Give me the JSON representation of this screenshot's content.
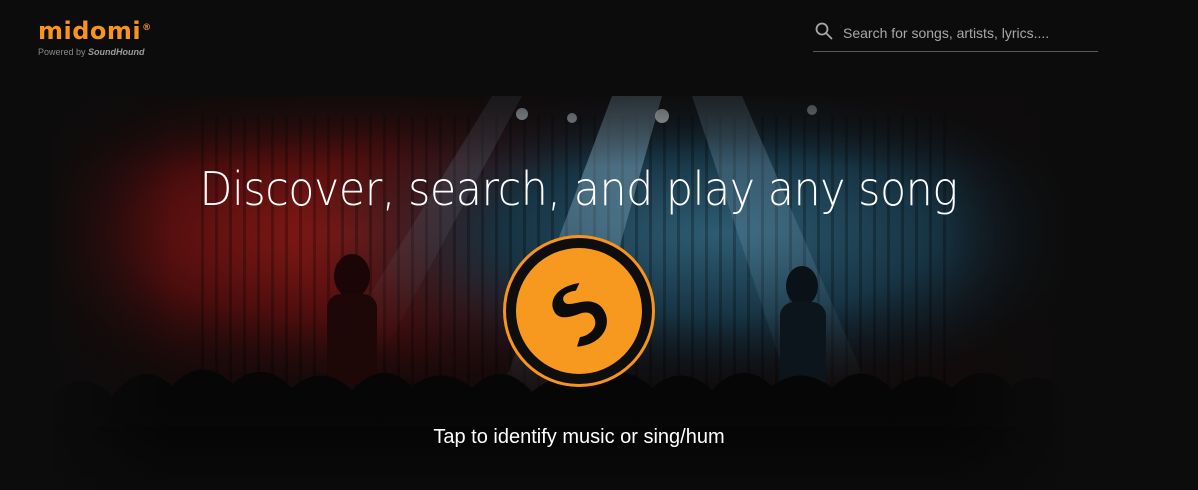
{
  "brand": {
    "name": "midomi",
    "trademark": "®",
    "powered_by": "Powered by",
    "powered_by_brand": "SoundHound",
    "accent_color": "#f7941d"
  },
  "search": {
    "placeholder": "Search for songs, artists, lyrics....",
    "value": "",
    "icon": "search-icon"
  },
  "hero": {
    "headline": "Discover, search, and play any song",
    "button_icon": "soundhound-logo-icon",
    "tap_text": "Tap to identify music or sing/hum",
    "background": "concert stage photo"
  }
}
